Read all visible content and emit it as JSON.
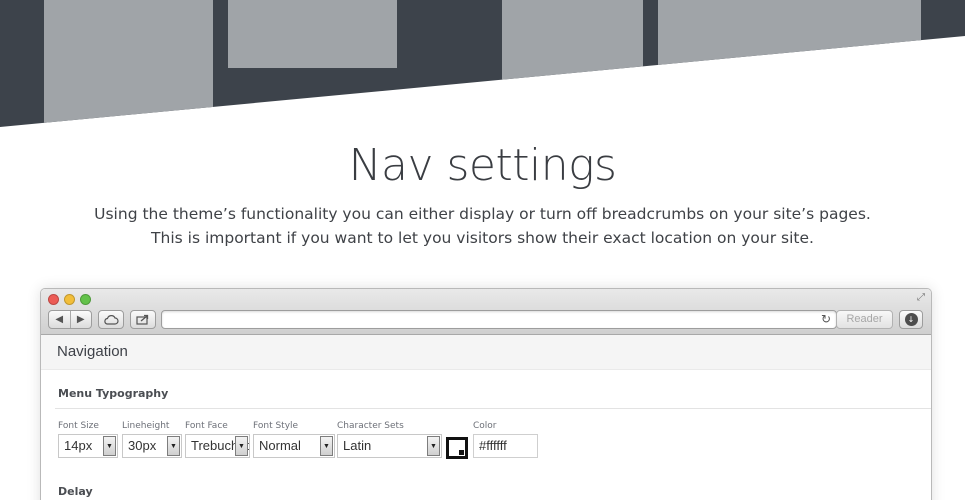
{
  "hero": {
    "title": "Nav settings",
    "description_line1": "Using the theme’s functionality you can either display or turn off breadcrumbs on your site’s pages.",
    "description_line2": "This is important if you want to let you visitors show their exact location on your site."
  },
  "browser": {
    "reader_label": "Reader",
    "address_value": ""
  },
  "panel": {
    "header_title": "Navigation",
    "section_title": "Menu Typography",
    "fields": {
      "font_size": {
        "label": "Font Size",
        "value": "14px"
      },
      "lineheight": {
        "label": "Lineheight",
        "value": "30px"
      },
      "font_face": {
        "label": "Font Face",
        "value": "Trebuchet"
      },
      "font_style": {
        "label": "Font Style",
        "value": "Normal"
      },
      "character_sets": {
        "label": "Character Sets",
        "value": "Latin"
      },
      "color": {
        "label": "Color",
        "value": "#ffffff"
      }
    },
    "next_section_title": "Delay"
  },
  "colors": {
    "banner_dark": "#3d434b",
    "banner_block": "#a0a4a8",
    "text_dark": "#3a3d42"
  },
  "icons": {
    "back": "back-arrow-icon",
    "forward": "forward-arrow-icon",
    "cloud": "cloud-icon",
    "share": "share-icon",
    "reload": "reload-icon",
    "download": "download-icon",
    "resize": "fullscreen-icon",
    "dropdown": "chevron-down-icon"
  }
}
